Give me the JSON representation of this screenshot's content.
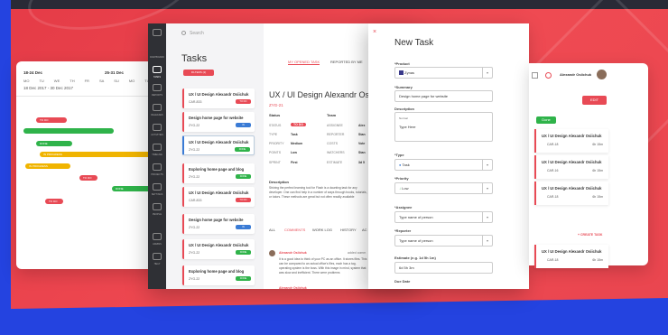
{
  "calendar": {
    "week_left": "18-24 Dec",
    "week_right": "25-31 Dec",
    "days": [
      "MO",
      "TU",
      "WE",
      "TH",
      "FR",
      "SA",
      "SU",
      "MO",
      "TU"
    ],
    "range": "18 Dec 2017 - 30 Dec 2017",
    "bars": [
      {
        "label": "TO DO",
        "color": "#e84a55"
      },
      {
        "label": "",
        "color": "#2fb34a"
      },
      {
        "label": "DONE",
        "color": "#2fb34a"
      },
      {
        "label": "IN PROGRESS",
        "color": "#f0b400"
      },
      {
        "label": "IN PROGRESS",
        "color": "#f0b400"
      },
      {
        "label": "TO DO",
        "color": "#e84a55"
      },
      {
        "label": "DONE",
        "color": "#2fb34a"
      },
      {
        "label": "TO DO",
        "color": "#e84a55"
      },
      {
        "label": "DONE",
        "color": "#2fb34a"
      }
    ]
  },
  "rail": {
    "items": [
      "DASHBOARD",
      "TASKS",
      "REPORTS",
      "RELEASES",
      "ACTIVITIES",
      "TIMELINE",
      "PROJECTS",
      "SETTINGS",
      "PEOPLE",
      "ADMINS",
      "HELP"
    ]
  },
  "search_placeholder": "Search",
  "tasks": {
    "title": "Tasks",
    "filter_label": "FILTERS (2)",
    "tab_open": "MY OPENED TASK",
    "tab_reported": "REPORTED BY ME",
    "cards": [
      {
        "title": "UX / UI Design Alexandr Osiichuk",
        "code": "CAR-833",
        "badge": "TO DO",
        "badge_color": "#e84a55"
      },
      {
        "title": "Design home page for website",
        "code": "ZYG-22",
        "badge": "IN PROGRESS",
        "badge_color": "#3a7bd5"
      },
      {
        "title": "UX / UI Design Alexandr Osiichuk",
        "code": "ZYG-22",
        "badge": "DONE",
        "badge_color": "#2fb34a"
      },
      {
        "title": "Exploring home page and blog",
        "code": "ZYG-22",
        "badge": "DONE",
        "badge_color": "#2fb34a"
      },
      {
        "title": "UX / UI Design Alexandr Osiichuk",
        "code": "CAR-833",
        "badge": "TO DO",
        "badge_color": "#e84a55"
      },
      {
        "title": "Design home page for website",
        "code": "ZYG-22",
        "badge": "IN PROGRESS",
        "badge_color": "#3a7bd5"
      },
      {
        "title": "UX / UI Design Alexandr Osiichuk",
        "code": "ZYG-22",
        "badge": "DONE",
        "badge_color": "#2fb34a"
      },
      {
        "title": "Exploring home page and blog",
        "code": "ZYG-22",
        "badge": "DONE",
        "badge_color": "#2fb34a"
      }
    ]
  },
  "detail": {
    "title": "UX / UI Design Alexandr Osiichuk",
    "code": "ZYG-21",
    "status_h": "Status",
    "team_h": "Team",
    "status_rows": [
      {
        "l": "STATUS",
        "v": "TO DO"
      },
      {
        "l": "TYPE",
        "v": "Task"
      },
      {
        "l": "PRIORITY",
        "v": "Medium"
      },
      {
        "l": "POINTS",
        "v": "Low"
      },
      {
        "l": "SPRINT",
        "v": "First"
      }
    ],
    "team_rows": [
      {
        "l": "ASSIGNEE",
        "v": "Alex"
      },
      {
        "l": "REPORTER",
        "v": "Stan"
      },
      {
        "l": "COSTS",
        "v": "Vote"
      },
      {
        "l": "WATCHERS",
        "v": "Stan"
      },
      {
        "l": "ESTIMATE",
        "v": "3d 5"
      }
    ],
    "desc_h": "Description",
    "desc": "Striving the perfect learning tool for Flash is a daunting task for any developer. One can find help in a number of ways through books, tutorials, or tutors. These methods are great but not often readily available",
    "activity_tabs": [
      "ALL",
      "COMMENTS",
      "WORK LOG",
      "HISTORY",
      "AC"
    ],
    "comments": [
      {
        "author": "Alexandr Osiichuk",
        "time": "added comm",
        "text": "It is a good idea to think of your PC as an office. It stores files. This can be compared to an actual office's files, each has a tag. operating system is the boss. With this image in mind, system that was slow and inefficient. There were problems"
      },
      {
        "author": "Alexandr Osiichuk",
        "time": "added comm",
        "text": ""
      }
    ]
  },
  "modal": {
    "close": "×",
    "title": "New Task",
    "product_l": "*Product",
    "product_v": "Zynas",
    "summary_l": "*Summary",
    "summary_v": "Design home page for website",
    "description_l": "Description",
    "toolbar_font": "Normal",
    "description_v": "Type Here",
    "type_l": "*Type",
    "type_v": "Task",
    "priority_l": "*Priority",
    "priority_v": "Low",
    "assignee_l": "*Assignee",
    "assignee_v": "Type name of person",
    "reporter_l": "*Reporter",
    "reporter_v": "Type name of person",
    "estimate_l": "Estimate (e.g. 1d 5h 1m)",
    "estimate_v": "6d 5h 3m",
    "due_l": "Due Date"
  },
  "board": {
    "user": "Alexandr Osiichuk",
    "edit_label": "EDIT",
    "done_label": "Done",
    "create_label": "+ CREATE TASK",
    "cards": [
      {
        "title": "UX / UI Design Alexandr Osiichuk",
        "code": "CAR-18",
        "est": "6h 15m"
      },
      {
        "title": "UX / UI Design Alexandr Osiichuk",
        "code": "CAR-16",
        "est": "6h 15m"
      },
      {
        "title": "UX / UI Design Alexandr Osiichuk",
        "code": "CAR-18",
        "est": "6h 15m"
      },
      {
        "title": "UX / UI Design Alexandr Osiichuk",
        "code": "CAR-18",
        "est": "6h 15m"
      }
    ]
  }
}
